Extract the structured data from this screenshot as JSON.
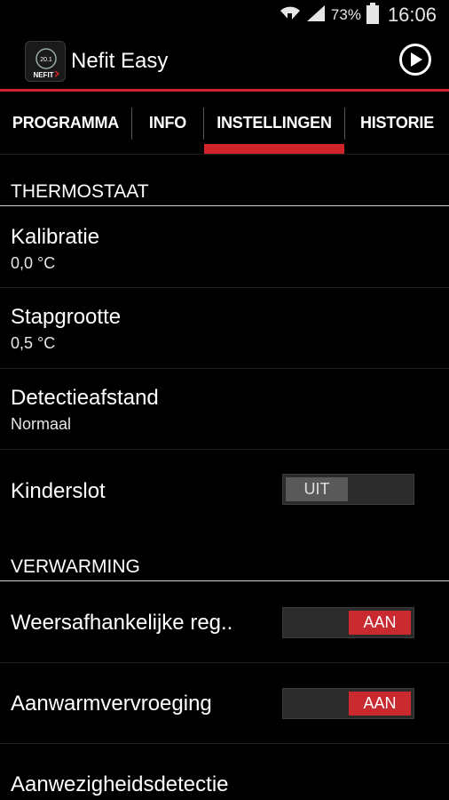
{
  "status_bar": {
    "battery": "73%",
    "time": "16:06"
  },
  "app": {
    "title": "Nefit Easy",
    "logo_text": "NEFIT",
    "logo_value": "20.1"
  },
  "tabs": [
    {
      "label": "PROGRAMMA",
      "selected": false
    },
    {
      "label": "INFO",
      "selected": false
    },
    {
      "label": "INSTELLINGEN",
      "selected": true
    },
    {
      "label": "HISTORIE",
      "selected": false
    }
  ],
  "sections": {
    "thermostaat": {
      "header": "THERMOSTAAT",
      "items": [
        {
          "title": "Kalibratie",
          "value": "0,0 °C"
        },
        {
          "title": "Stapgrootte",
          "value": "0,5 °C"
        },
        {
          "title": "Detectieafstand",
          "value": "Normaal"
        },
        {
          "title": "Kinderslot",
          "toggle": "UIT",
          "toggle_on": false
        }
      ]
    },
    "verwarming": {
      "header": "VERWARMING",
      "items": [
        {
          "title": "Weersafhankelijke reg..",
          "toggle": "AAN",
          "toggle_on": true
        },
        {
          "title": "Aanwarmvervroeging",
          "toggle": "AAN",
          "toggle_on": true
        },
        {
          "title": "Aanwezigheidsdetectie"
        }
      ]
    }
  },
  "colors": {
    "accent": "#d0232a",
    "toggle_on": "#c92a30",
    "background": "#000000"
  }
}
